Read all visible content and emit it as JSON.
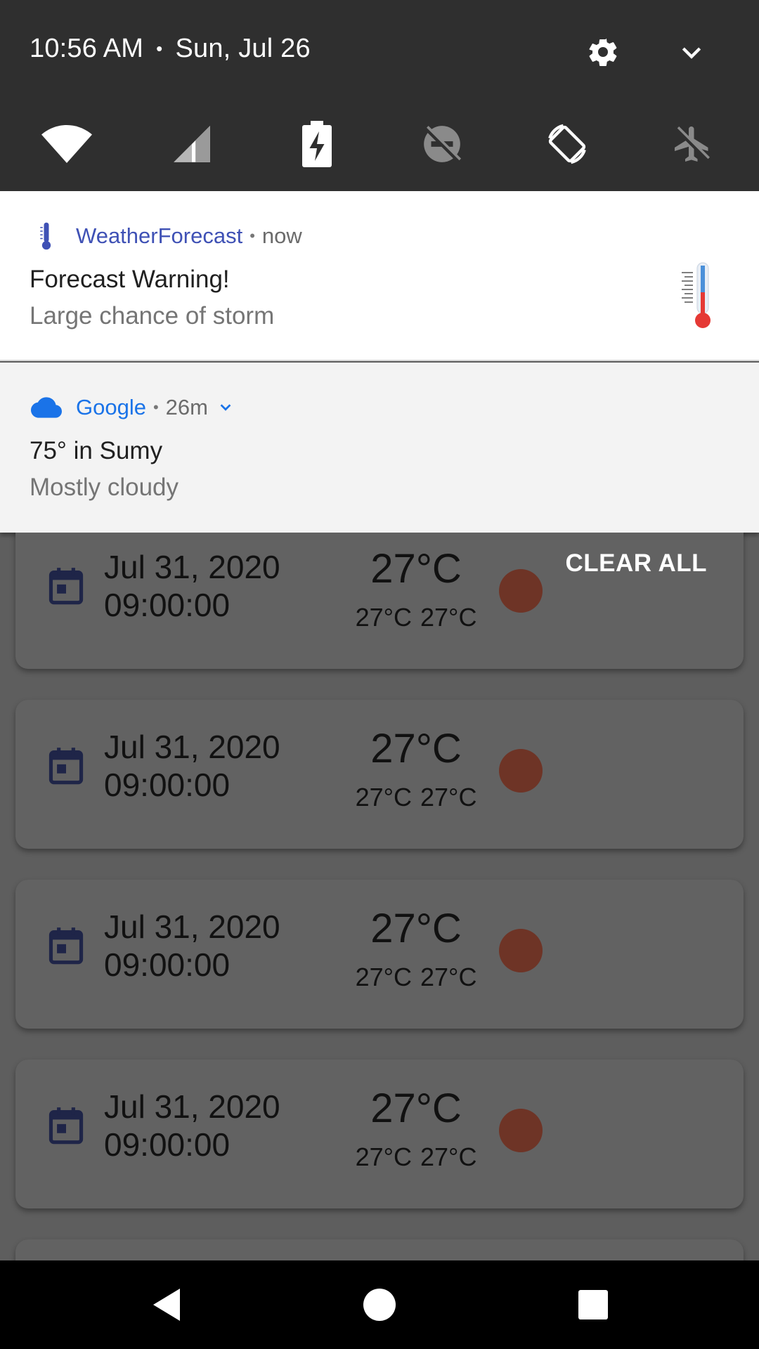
{
  "status": {
    "time": "10:56 AM",
    "separator": "•",
    "date": "Sun, Jul 26"
  },
  "quick_settings": [
    {
      "name": "wifi-icon",
      "state": "on"
    },
    {
      "name": "cellular-signal-icon",
      "state": "on"
    },
    {
      "name": "battery-charging-icon",
      "state": "on"
    },
    {
      "name": "do-not-disturb-icon",
      "state": "off"
    },
    {
      "name": "auto-rotate-icon",
      "state": "on"
    },
    {
      "name": "airplane-mode-icon",
      "state": "off"
    }
  ],
  "notifications": [
    {
      "app": "WeatherForecast",
      "separator": "•",
      "time": "now",
      "title": "Forecast Warning!",
      "text": "Large chance of storm",
      "app_color": "#3f51b5"
    },
    {
      "app": "Google",
      "separator": "•",
      "time": "26m",
      "title": "75° in Sumy",
      "text": "Mostly cloudy",
      "app_color": "#1a73e8"
    }
  ],
  "clear_all": "CLEAR ALL",
  "cards": [
    {
      "date": "Jul 31, 2020",
      "time": "09:00:00",
      "temp": "27°C",
      "min": "27°C",
      "max": "27°C"
    },
    {
      "date": "Jul 31, 2020",
      "time": "09:00:00",
      "temp": "27°C",
      "min": "27°C",
      "max": "27°C"
    },
    {
      "date": "Jul 31, 2020",
      "time": "09:00:00",
      "temp": "27°C",
      "min": "27°C",
      "max": "27°C"
    },
    {
      "date": "Jul 31, 2020",
      "time": "09:00:00",
      "temp": "27°C",
      "min": "27°C",
      "max": "27°C"
    }
  ],
  "colors": {
    "shade": "#2f2f2f",
    "indicator": "#6e3426",
    "calendar": "#1f2548"
  }
}
